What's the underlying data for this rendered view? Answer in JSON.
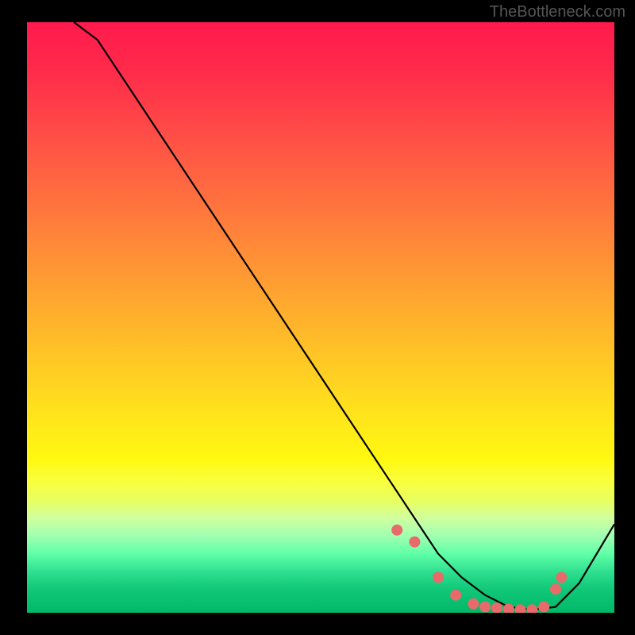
{
  "watermark": "TheBottleneck.com",
  "chart_data": {
    "type": "line",
    "title": "",
    "xlabel": "",
    "ylabel": "",
    "xlim": [
      0,
      100
    ],
    "ylim": [
      0,
      100
    ],
    "grid": false,
    "series": [
      {
        "name": "curve",
        "x": [
          8,
          12,
          20,
          30,
          40,
          50,
          58,
          62,
          66,
          70,
          74,
          78,
          82,
          86,
          90,
          94,
          100
        ],
        "y": [
          100,
          97,
          85,
          70,
          55,
          40,
          28,
          22,
          16,
          10,
          6,
          3,
          1,
          0.5,
          1,
          5,
          15
        ]
      }
    ],
    "markers": {
      "name": "highlight-points",
      "x": [
        63,
        66,
        70,
        73,
        76,
        78,
        80,
        82,
        84,
        86,
        88,
        90,
        91
      ],
      "y": [
        14,
        12,
        6,
        3,
        1.5,
        1,
        0.8,
        0.6,
        0.5,
        0.5,
        1,
        4,
        6
      ]
    },
    "background": "rainbow-vertical-gradient"
  }
}
